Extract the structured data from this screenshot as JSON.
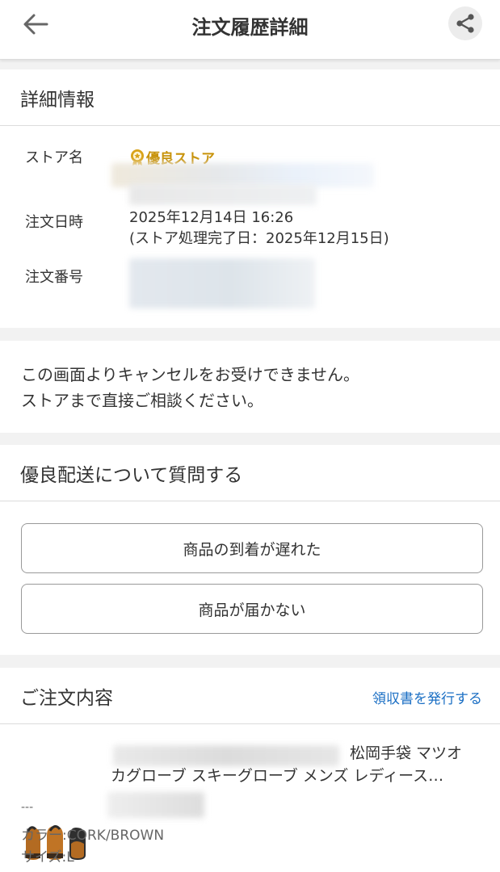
{
  "header": {
    "title": "注文履歴詳細"
  },
  "details": {
    "section_title": "詳細情報",
    "store_label": "ストア名",
    "store_badge": "優良ストア",
    "date_label": "注文日時",
    "date_value": "2025年12月14日 16:26",
    "date_note": "(ストア処理完了日：2025年12月15日)",
    "order_no_label": "注文番号"
  },
  "notice": {
    "line1": "この画面よりキャンセルをお受けできません。",
    "line2": "ストアまで直接ご相談ください。"
  },
  "delivery_question": {
    "section_title": "優良配送について質問する",
    "buttons": [
      "商品の到着が遅れた",
      "商品が届かない"
    ]
  },
  "order_contents": {
    "section_title": "ご注文内容",
    "receipt_link": "領収書を発行する",
    "product": {
      "name_visible": "松岡手袋 マツオカグローブ スキーグローブ メンズ レディース…",
      "dash": "---",
      "color": "カラー:CORK/BROWN",
      "size": "サイズ:L"
    }
  },
  "colors": {
    "link": "#1b6fc4",
    "badge_gold": "#c8930a",
    "divider": "#dcdcdc",
    "page_bg": "#f2f2f2"
  }
}
